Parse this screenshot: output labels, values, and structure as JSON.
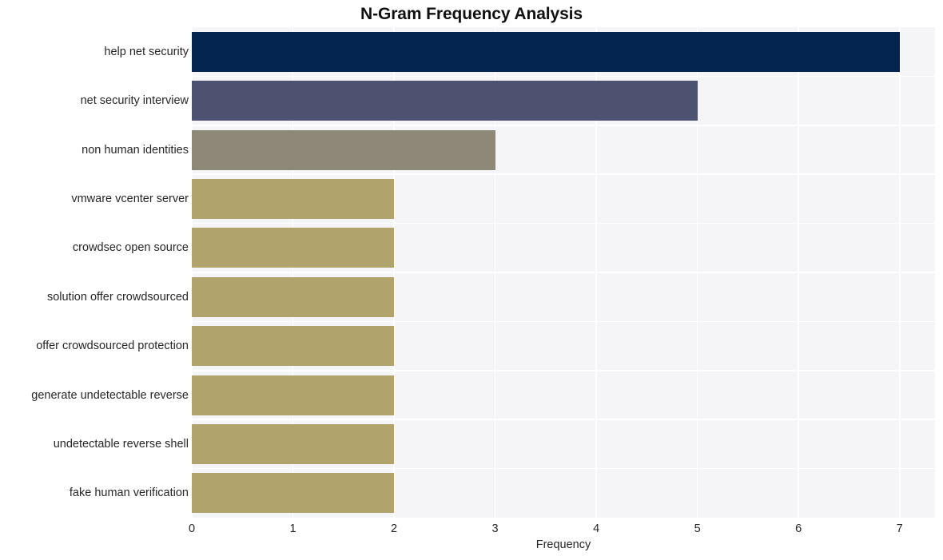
{
  "chart_data": {
    "type": "bar",
    "orientation": "horizontal",
    "title": "N-Gram Frequency Analysis",
    "xlabel": "Frequency",
    "ylabel": "",
    "xlim": [
      0,
      7.35
    ],
    "xticks": [
      "0",
      "1",
      "2",
      "3",
      "4",
      "5",
      "6",
      "7"
    ],
    "xtick_values": [
      0,
      1,
      2,
      3,
      4,
      5,
      6,
      7
    ],
    "grid": true,
    "legend": null,
    "categories": [
      "help net security",
      "net security interview",
      "non human identities",
      "vmware vcenter server",
      "crowdsec open source",
      "solution offer crowdsourced",
      "offer crowdsourced protection",
      "generate undetectable reverse",
      "undetectable reverse shell",
      "fake human verification"
    ],
    "values": [
      7,
      5,
      3,
      2,
      2,
      2,
      2,
      2,
      2,
      2
    ],
    "bar_colors": [
      "#03254f",
      "#4d5270",
      "#8d8878",
      "#b0a36b",
      "#b0a36b",
      "#b0a36b",
      "#b0a36b",
      "#b0a36b",
      "#b0a36b",
      "#b0a36b"
    ],
    "plot_background": "#f5f5f7",
    "grid_color": "#ffffff",
    "figure_background": "#ffffff",
    "text_color": "#262626"
  }
}
